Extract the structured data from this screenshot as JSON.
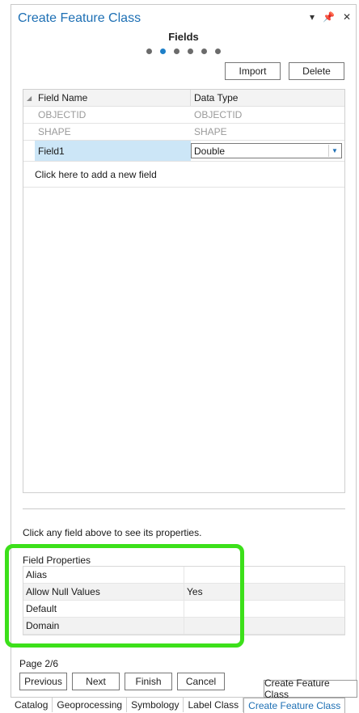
{
  "pane": {
    "title": "Create Feature Class",
    "menu_icon": "chevron-down",
    "pin_icon": "pin",
    "close_icon": "close"
  },
  "step": {
    "title": "Fields",
    "dots_count": 6,
    "active_index": 1
  },
  "actions": {
    "import": "Import",
    "delete": "Delete"
  },
  "grid": {
    "headers": [
      "Field Name",
      "Data Type"
    ],
    "rows": [
      {
        "name": "OBJECTID",
        "type": "OBJECTID"
      },
      {
        "name": "SHAPE",
        "type": "SHAPE"
      },
      {
        "name": "Field1",
        "type": "Double"
      }
    ],
    "add_row": "Click here to add a new field"
  },
  "hint": "Click any field above to see its properties.",
  "field_properties": {
    "label": "Field Properties",
    "rows": [
      {
        "key": "Alias",
        "value": ""
      },
      {
        "key": "Allow Null Values",
        "value": "Yes"
      },
      {
        "key": "Default",
        "value": ""
      },
      {
        "key": "Domain",
        "value": ""
      }
    ]
  },
  "page_indicator": "Page 2/6",
  "nav": {
    "previous": "Previous",
    "next": "Next",
    "finish": "Finish",
    "cancel": "Cancel"
  },
  "tooltip": "Create Feature Class",
  "bottom_tabs": [
    "Catalog",
    "Geoprocessing",
    "Symbology",
    "Label Class",
    "Create Feature Class"
  ],
  "colors": {
    "accent": "#1d6fb4",
    "highlight": "#3ce01a",
    "selected_row": "#cce6f7"
  }
}
